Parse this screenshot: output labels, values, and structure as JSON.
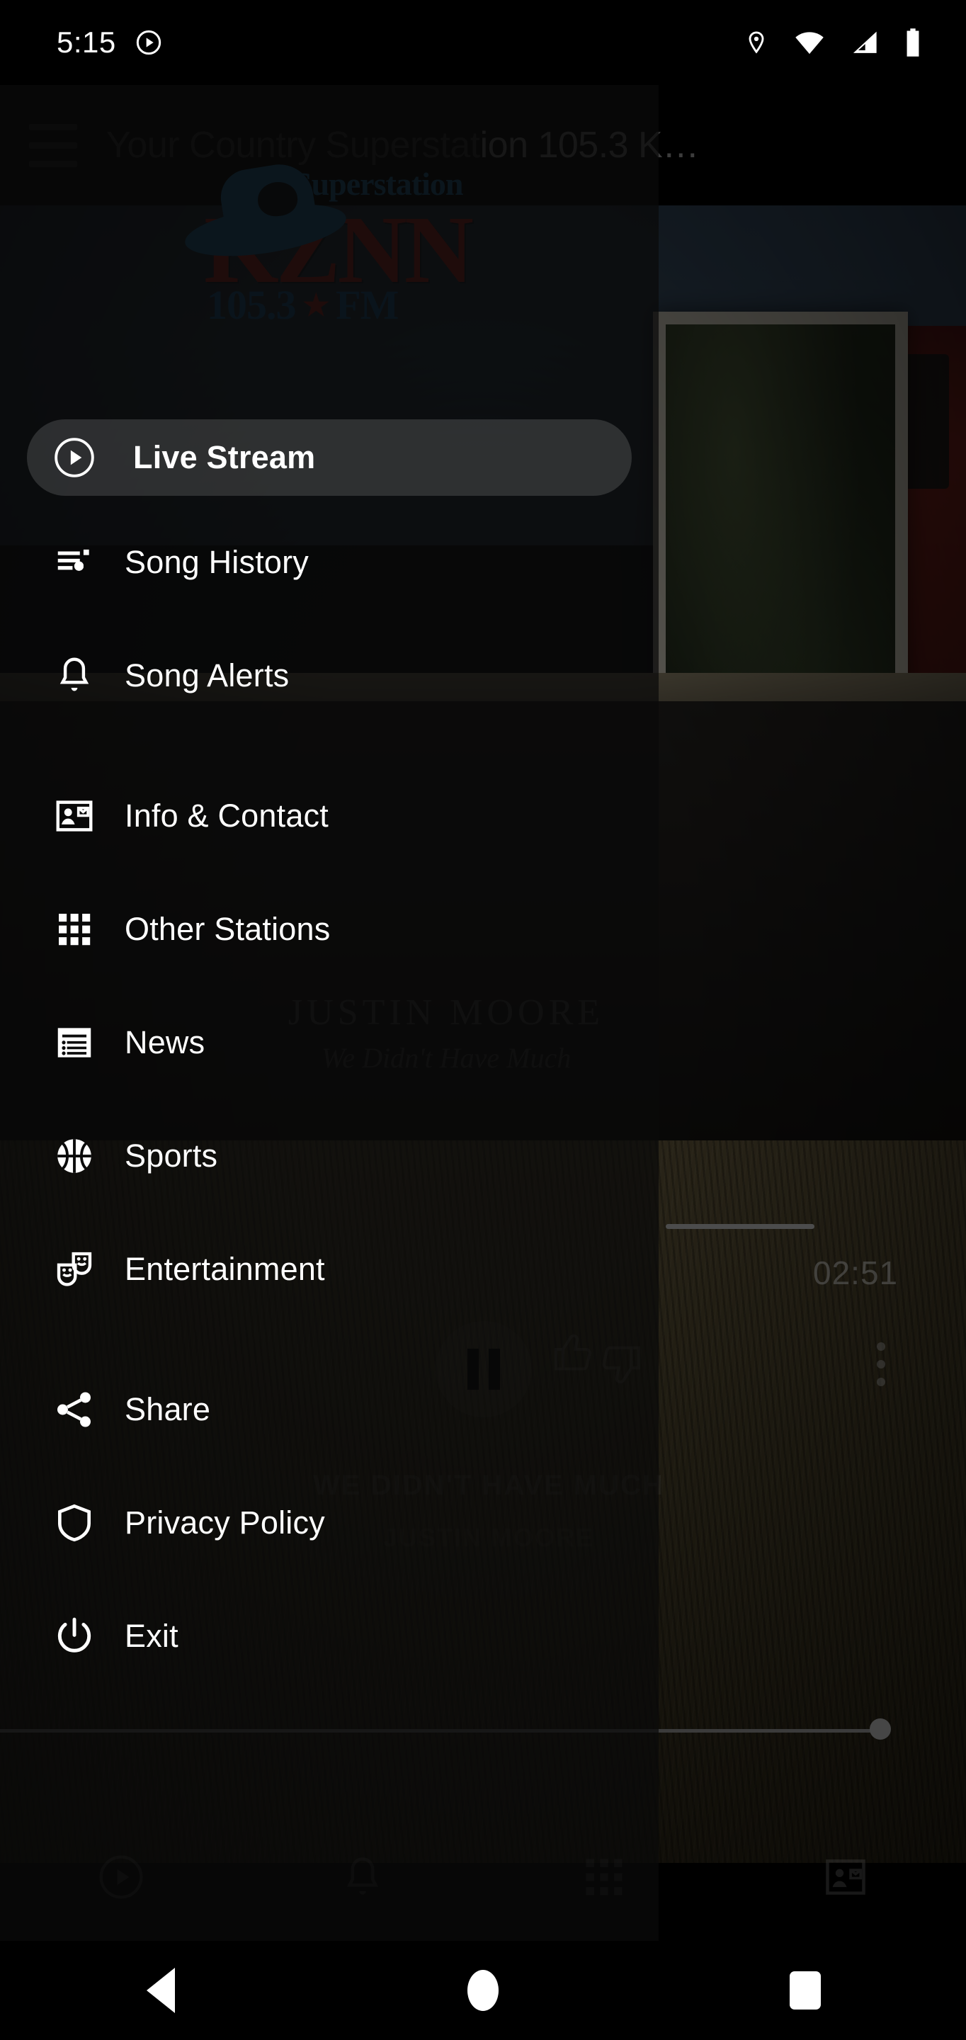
{
  "statusbar": {
    "clock": "5:15",
    "cast_icon": "play-circle-icon",
    "icons": [
      "location-pin-icon",
      "wifi-icon",
      "cellular-signal-icon",
      "battery-icon"
    ]
  },
  "appbar": {
    "menu_icon": "hamburger-menu-icon",
    "title_dim": "Your Country Superstat",
    "title_bright": "ion 105.3 K…"
  },
  "logo": {
    "superstation": "Superstation",
    "call_letters": "KZNN",
    "frequency": "105.3",
    "star": "★",
    "band": "FM",
    "hat_color": "#2b8fd4",
    "call_color": "#e2302c",
    "band_color": "#1f7fc4"
  },
  "drawer": {
    "items": [
      {
        "label": "Live Stream",
        "icon": "play-circle-icon",
        "selected": true
      },
      {
        "label": "Song History",
        "icon": "playlist-music-icon",
        "selected": false
      },
      {
        "label": "Song Alerts",
        "icon": "bell-icon",
        "selected": false
      },
      {
        "label": "Info & Contact",
        "icon": "contact-card-icon",
        "selected": false
      },
      {
        "label": "Other Stations",
        "icon": "grid-apps-icon",
        "selected": false
      },
      {
        "label": "News",
        "icon": "news-list-icon",
        "selected": false
      },
      {
        "label": "Sports",
        "icon": "basketball-icon",
        "selected": false
      },
      {
        "label": "Entertainment",
        "icon": "theater-masks-icon",
        "selected": false
      },
      {
        "label": "Share",
        "icon": "share-icon",
        "selected": false
      },
      {
        "label": "Privacy Policy",
        "icon": "shield-icon",
        "selected": false
      },
      {
        "label": "Exit",
        "icon": "power-icon",
        "selected": false
      }
    ]
  },
  "player": {
    "time_remaining": "02:51",
    "state_icon": "pause-icon",
    "thumb_up_icon": "thumb-up-icon",
    "thumb_down_icon": "thumb-down-icon",
    "overflow_icon": "kebab-menu-icon",
    "video_artist": "JUSTIN MOORE",
    "video_song_script": "We Didn't Have Much",
    "video_song_caps": "WE DIDN'T HAVE MUCH",
    "video_artist_caps": "JUSTIN MOORE"
  },
  "bottom_bar": {
    "items": [
      {
        "icon": "play-circle-icon"
      },
      {
        "icon": "bell-icon"
      },
      {
        "icon": "grid-apps-icon"
      },
      {
        "icon": "contact-card-icon"
      }
    ]
  },
  "navbar": {
    "back": "back-triangle-icon",
    "home": "home-circle-icon",
    "recents": "recents-square-icon"
  }
}
